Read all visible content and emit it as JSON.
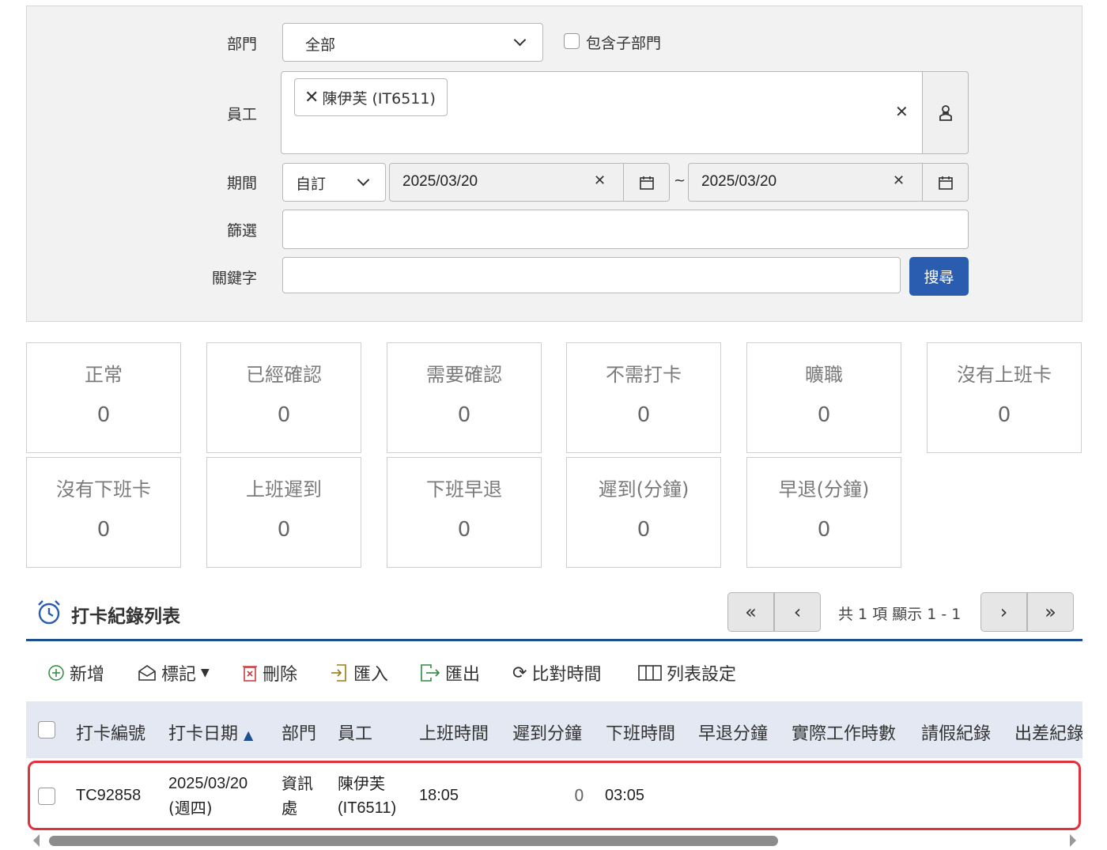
{
  "filters": {
    "department_label": "部門",
    "department_value": "全部",
    "include_sub_label": "包含子部門",
    "employee_label": "員工",
    "employee_chip": "陳伊芙 (IT6511)",
    "period_label": "期間",
    "period_mode": "自訂",
    "date_from": "2025/03/20",
    "date_sep": "~",
    "date_to": "2025/03/20",
    "filter_label": "篩選",
    "keyword_label": "關鍵字",
    "search_button": "搜尋"
  },
  "stats": [
    {
      "label": "正常",
      "value": "0"
    },
    {
      "label": "已經確認",
      "value": "0"
    },
    {
      "label": "需要確認",
      "value": "0"
    },
    {
      "label": "不需打卡",
      "value": "0"
    },
    {
      "label": "曠職",
      "value": "0"
    },
    {
      "label": "沒有上班卡",
      "value": "0"
    },
    {
      "label": "沒有下班卡",
      "value": "0"
    },
    {
      "label": "上班遲到",
      "value": "0"
    },
    {
      "label": "下班早退",
      "value": "0"
    },
    {
      "label": "遲到(分鐘)",
      "value": "0"
    },
    {
      "label": "早退(分鐘)",
      "value": "0"
    }
  ],
  "list": {
    "title": "打卡紀錄列表",
    "pager_text": "共 1 項 顯示 1 - 1",
    "toolbar": {
      "add": "新增",
      "mark": "標記",
      "delete": "刪除",
      "import": "匯入",
      "export": "匯出",
      "compare": "比對時間",
      "list_settings": "列表設定"
    },
    "columns": [
      "打卡編號",
      "打卡日期",
      "部門",
      "員工",
      "上班時間",
      "遲到分鐘",
      "下班時間",
      "早退分鐘",
      "實際工作時數",
      "請假紀錄",
      "出差紀錄"
    ],
    "rows": [
      {
        "id": "TC92858",
        "date": "2025/03/20",
        "weekday": "(週四)",
        "dept_line1": "資訊",
        "dept_line2": "處",
        "emp_line1": "陳伊芙",
        "emp_line2": "(IT6511)",
        "in_time": "18:05",
        "late_min": "0",
        "out_time": "03:05"
      }
    ]
  },
  "colors": {
    "accent": "#2a5db0",
    "highlight": "#e0313e",
    "header_bg": "#e3e8f3"
  }
}
